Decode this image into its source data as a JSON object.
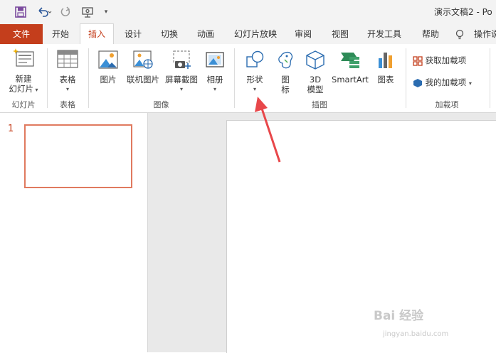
{
  "window": {
    "title": "演示文稿2 - Po"
  },
  "tabs": [
    {
      "label": "文件"
    },
    {
      "label": "开始"
    },
    {
      "label": "插入"
    },
    {
      "label": "设计"
    },
    {
      "label": "切换"
    },
    {
      "label": "动画"
    },
    {
      "label": "幻灯片放映"
    },
    {
      "label": "审阅"
    },
    {
      "label": "视图"
    },
    {
      "label": "开发工具"
    },
    {
      "label": "帮助"
    },
    {
      "label": "操作说"
    }
  ],
  "ribbon": {
    "groups": {
      "slides": "幻灯片",
      "tables": "表格",
      "images": "图像",
      "illustrations": "插图",
      "addins": "加载项"
    },
    "new_slide_line1": "新建",
    "new_slide_line2": "幻灯片",
    "table": "表格",
    "picture": "图片",
    "online_picture": "联机图片",
    "screenshot": "屏幕截图",
    "album": "相册",
    "shapes": "形状",
    "icons_line1": "图",
    "icons_line2": "标",
    "model3d_line1": "3D",
    "model3d_line2": "模型",
    "smartart": "SmartArt",
    "chart": "图表",
    "get_addins": "获取加载项",
    "my_addins": "我的加载项"
  },
  "slides_pane": {
    "slide_number": "1"
  },
  "watermark": {
    "main": "Bai 经验",
    "sub": "jingyan.baidu.com"
  },
  "colors": {
    "accent": "#c43e1c",
    "arrow": "#e8474a",
    "thumb_border": "#e07a5f"
  }
}
